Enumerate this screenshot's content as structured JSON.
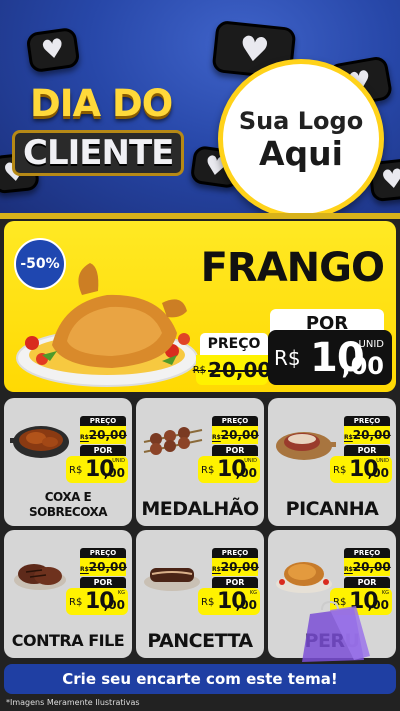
{
  "header": {
    "title_line1": "DIA DO",
    "title_line2": "CLIENTE",
    "logo_line1": "Sua Logo",
    "logo_line2": "Aqui"
  },
  "featured": {
    "badge": "-50%",
    "name": "FRANGO",
    "por_label": "POR",
    "preco_label": "PREÇO",
    "old_currency": "R$",
    "old_price": "20,00",
    "new_currency": "R$",
    "new_int": "10",
    "new_dec": ",00",
    "unit": "UNID"
  },
  "products": [
    {
      "name": "COXA E SOBRECOXA",
      "preco_label": "PREÇO",
      "old_currency": "R$",
      "old_price": "20,00",
      "por_label": "POR",
      "new_currency": "R$",
      "new_int": "10",
      "new_dec": ",00",
      "unit": "UNID"
    },
    {
      "name": "MEDALHÃO",
      "preco_label": "PREÇO",
      "old_currency": "R$",
      "old_price": "20,00",
      "por_label": "POR",
      "new_currency": "R$",
      "new_int": "10",
      "new_dec": ",00",
      "unit": "UNID"
    },
    {
      "name": "PICANHA",
      "preco_label": "PREÇO",
      "old_currency": "R$",
      "old_price": "20,00",
      "por_label": "POR",
      "new_currency": "R$",
      "new_int": "10",
      "new_dec": ",00",
      "unit": "UNID"
    },
    {
      "name": "CONTRA FILE",
      "preco_label": "PREÇO",
      "old_currency": "R$",
      "old_price": "20,00",
      "por_label": "POR",
      "new_currency": "R$",
      "new_int": "10",
      "new_dec": ",00",
      "unit": "KG"
    },
    {
      "name": "PANCETTA",
      "preco_label": "PREÇO",
      "old_currency": "R$",
      "old_price": "20,00",
      "por_label": "POR",
      "new_currency": "R$",
      "new_int": "10",
      "new_dec": ",00",
      "unit": "KG"
    },
    {
      "name": "PERU",
      "preco_label": "PREÇO",
      "old_currency": "R$",
      "old_price": "20,00",
      "por_label": "POR",
      "new_currency": "R$",
      "new_int": "10",
      "new_dec": ",00",
      "unit": "KG"
    }
  ],
  "cta": {
    "label": "Crie seu encarte com este tema!"
  },
  "footnote": "*Imagens Meramente Ilustrativas",
  "colors": {
    "header_blue": "#2747a8",
    "accent_yellow": "#fff200",
    "title_gold": "#ffd93a",
    "cta_blue": "#1f3fa3",
    "card_gray": "#d6d6d6"
  },
  "icons": {
    "bubble": "heart-icon",
    "bag": "shopping-bag-icon"
  }
}
